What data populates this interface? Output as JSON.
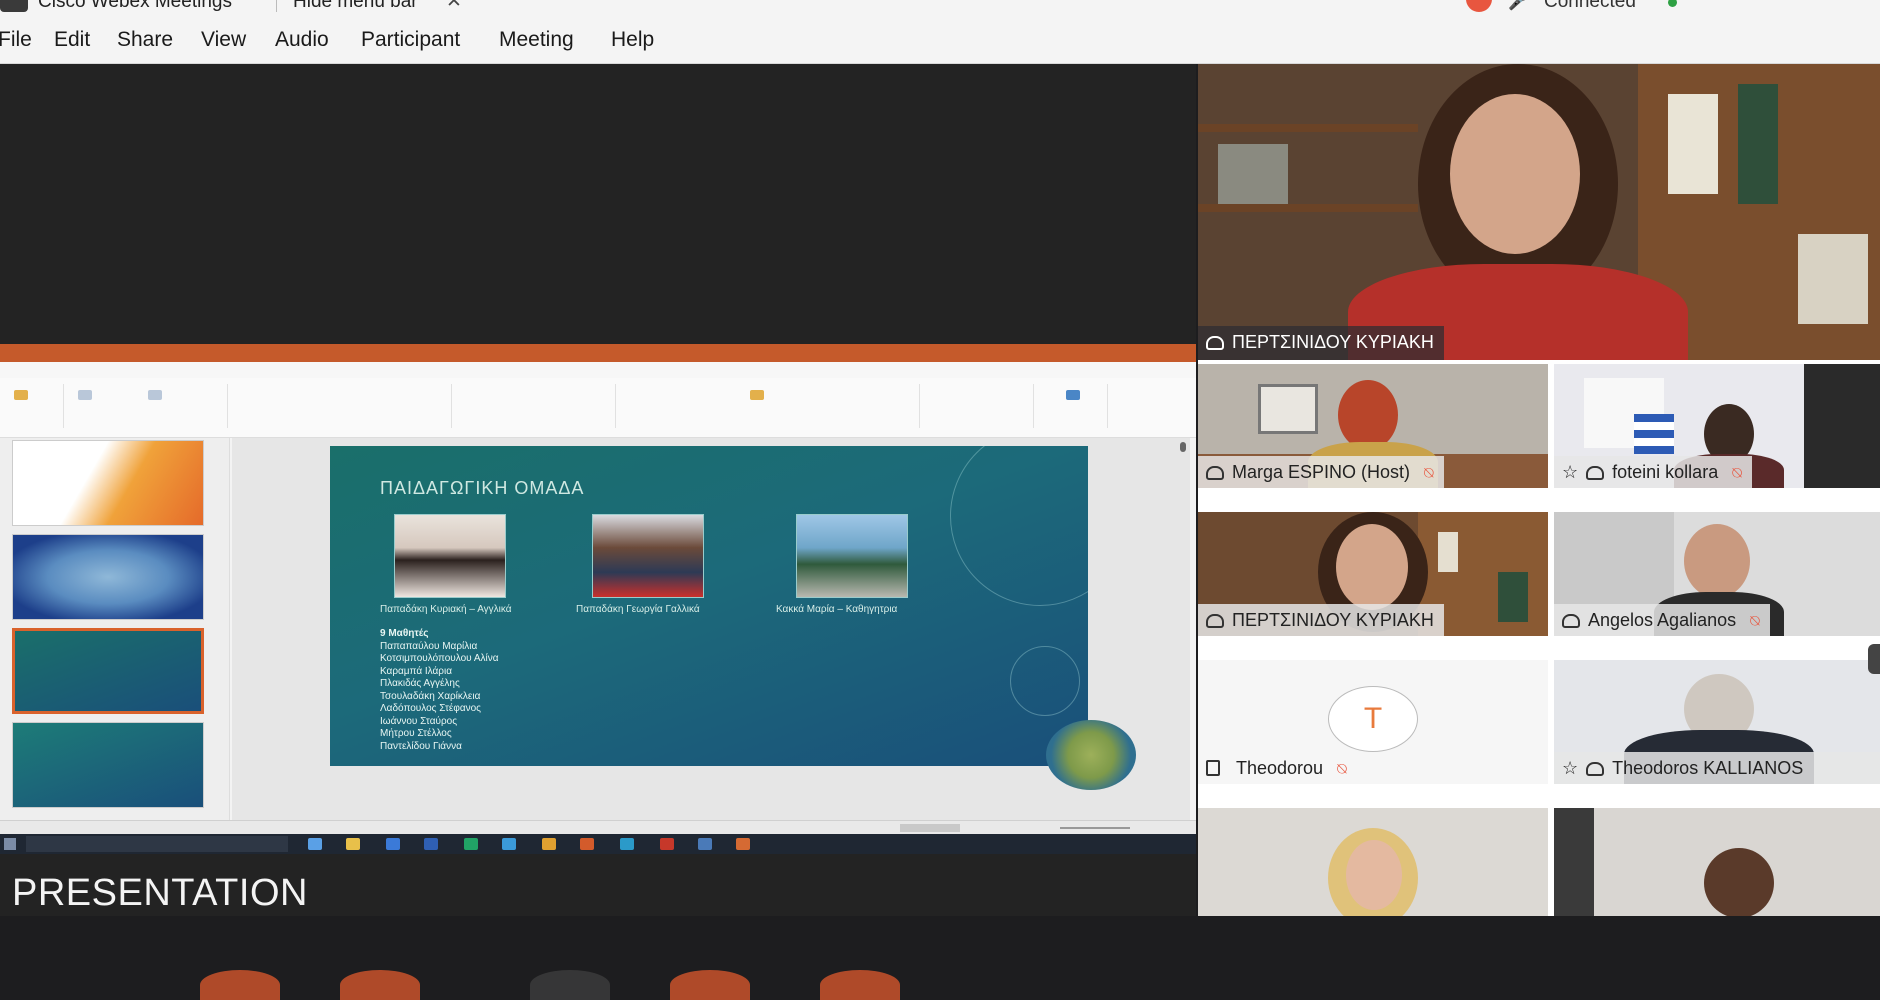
{
  "titlebar": {
    "app_title": "Cisco Webex Meetings",
    "hide_menu": "Hide menu bar",
    "hide_close": "✕",
    "connection": "Connected"
  },
  "menu": [
    "File",
    "Edit",
    "Share",
    "View",
    "Audio",
    "Participant",
    "Meeting",
    "Help"
  ],
  "presentation": {
    "label": "PRESENTATION",
    "slide": {
      "title": "ΠΑΙΔΑΓΩΓΙΚΗ ΟΜΑΔΑ",
      "captions": [
        "Παπαδάκη Κυριακή – Αγγλικά",
        "Παπαδάκη Γεωργία Γαλλικά",
        "Κακκά Μαρία – Καθηγητρια"
      ],
      "students_heading": "9 Μαθητές",
      "students": [
        "Παπαπαύλου Μαρίλια",
        "Κοτσιμπουλόπουλου Αλίνα",
        "Καραμπά Ιλάρια",
        "Πλακιδάς Αγγέλης",
        "Τσουλαδάκη Χαρίκλεια",
        "Λαδόπουλος Στέφανος",
        "Ιωάννου Σταύρος",
        "Μήτρου Στέλλος",
        "Παντελίδου Γιάννα"
      ]
    }
  },
  "participants": [
    {
      "name": "ΠΕΡΤΣΙΝΙΔΟΥ ΚΥΡΙΑΚΗ",
      "muted": false
    },
    {
      "name": "Marga ESPINO (Host)",
      "muted": true
    },
    {
      "name": "foteini kollara",
      "muted": true
    },
    {
      "name": "ΠΕΡΤΣΙΝΙΔΟΥ ΚΥΡΙΑΚΗ",
      "muted": false
    },
    {
      "name": "Angelos Agalianos",
      "muted": true
    },
    {
      "name": "Theodorou",
      "muted": true,
      "avatar_letter": "T"
    },
    {
      "name": "Theodoros KALLIANOS",
      "muted": false
    },
    {
      "name": "",
      "muted": false
    },
    {
      "name": "",
      "muted": false
    }
  ],
  "colors": {
    "accent_orange": "#e8563f",
    "ppt_orange": "#c55a2b",
    "connected_green": "#2ea043"
  }
}
